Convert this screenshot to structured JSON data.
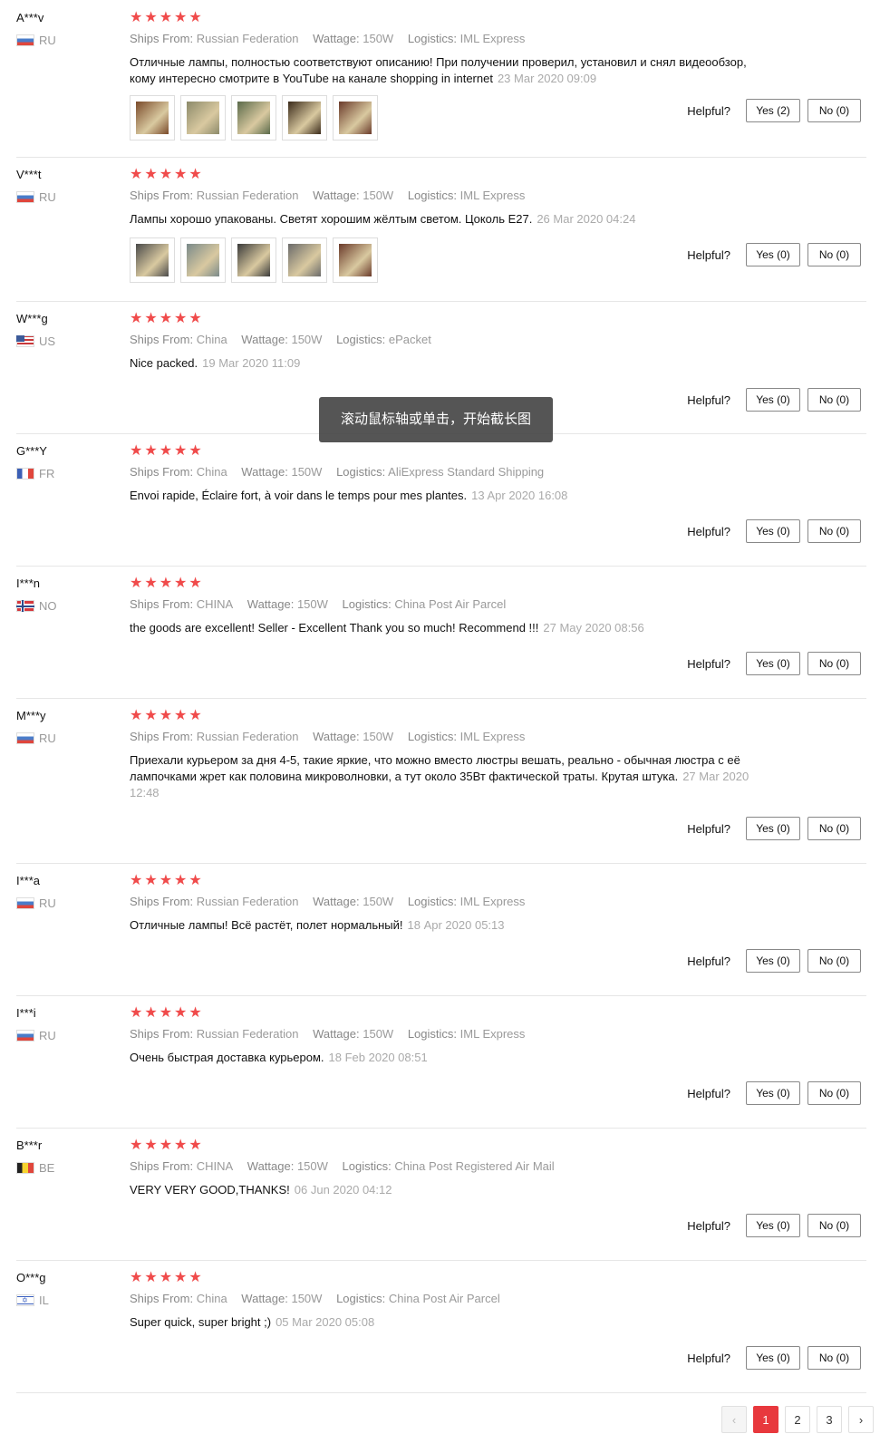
{
  "labels": {
    "ships_from": "Ships From:",
    "wattage": "Wattage:",
    "logistics": "Logistics:",
    "helpful": "Helpful?"
  },
  "toast": "滚动鼠标轴或单击，开始截长图",
  "reviews": [
    {
      "name": "A***v",
      "country": "RU",
      "flag": "ru",
      "ships_from": "Russian Federation",
      "wattage": "150W",
      "logistics": "IML Express",
      "text": "Отличные лампы, полностью соответствуют описанию! При получении проверил, установил и снял видеообзор, кому интересно смотрите в YouTube на канале shopping in internet",
      "date": "23 Mar 2020 09:09",
      "yes": "Yes (2)",
      "no": "No (0)",
      "photos": [
        "#7a4a2a",
        "#8c8a6a",
        "#5a6a4a",
        "#3a2a1a",
        "#6a3a2a"
      ]
    },
    {
      "name": "V***t",
      "country": "RU",
      "flag": "ru",
      "ships_from": "Russian Federation",
      "wattage": "150W",
      "logistics": "IML Express",
      "text": "Лампы хорошо упакованы. Светят хорошим жёлтым светом. Цоколь E27.",
      "date": "26 Mar 2020 04:24",
      "yes": "Yes (0)",
      "no": "No (0)",
      "photos": [
        "#4a4a4a",
        "#7a8a8a",
        "#3a3a3a",
        "#6a6a6a",
        "#6a3a2a"
      ]
    },
    {
      "name": "W***g",
      "country": "US",
      "flag": "us",
      "ships_from": "China",
      "wattage": "150W",
      "logistics": "ePacket",
      "text": "Nice packed.",
      "date": "19 Mar 2020 11:09",
      "yes": "Yes (0)",
      "no": "No (0)",
      "photos": []
    },
    {
      "name": "G***Y",
      "country": "FR",
      "flag": "fr",
      "ships_from": "China",
      "wattage": "150W",
      "logistics": "AliExpress Standard Shipping",
      "text": "Envoi rapide, Éclaire fort, à voir dans le temps pour mes plantes.",
      "date": "13 Apr 2020 16:08",
      "yes": "Yes (0)",
      "no": "No (0)",
      "photos": []
    },
    {
      "name": "I***n",
      "country": "NO",
      "flag": "no",
      "ships_from": "CHINA",
      "wattage": "150W",
      "logistics": "China Post Air Parcel",
      "text": "the goods are excellent! Seller - Excellent Thank you so much! Recommend !!!",
      "date": "27 May 2020 08:56",
      "yes": "Yes (0)",
      "no": "No (0)",
      "photos": []
    },
    {
      "name": "M***y",
      "country": "RU",
      "flag": "ru",
      "ships_from": "Russian Federation",
      "wattage": "150W",
      "logistics": "IML Express",
      "text": "Приехали курьером за дня 4-5, такие яркие, что можно вместо люстры вешать, реально - обычная люстра с её лампочками жрет как половина микроволновки, а тут около 35Вт фактической траты. Крутая штука.",
      "date": "27 Mar 2020 12:48",
      "yes": "Yes (0)",
      "no": "No (0)",
      "photos": []
    },
    {
      "name": "I***a",
      "country": "RU",
      "flag": "ru",
      "ships_from": "Russian Federation",
      "wattage": "150W",
      "logistics": "IML Express",
      "text": "Отличные лампы! Всё растёт, полет нормальный!",
      "date": "18 Apr 2020 05:13",
      "yes": "Yes (0)",
      "no": "No (0)",
      "photos": []
    },
    {
      "name": "I***i",
      "country": "RU",
      "flag": "ru",
      "ships_from": "Russian Federation",
      "wattage": "150W",
      "logistics": "IML Express",
      "text": "Очень быстрая доставка курьером.",
      "date": "18 Feb 2020 08:51",
      "yes": "Yes (0)",
      "no": "No (0)",
      "photos": []
    },
    {
      "name": "B***r",
      "country": "BE",
      "flag": "be",
      "ships_from": "CHINA",
      "wattage": "150W",
      "logistics": "China Post Registered Air Mail",
      "text": "VERY VERY GOOD,THANKS!",
      "date": "06 Jun 2020 04:12",
      "yes": "Yes (0)",
      "no": "No (0)",
      "photos": []
    },
    {
      "name": "O***g",
      "country": "IL",
      "flag": "il",
      "ships_from": "China",
      "wattage": "150W",
      "logistics": "China Post Air Parcel",
      "text": "Super quick, super bright ;)",
      "date": "05 Mar 2020 05:08",
      "yes": "Yes (0)",
      "no": "No (0)",
      "photos": []
    }
  ],
  "pagination": {
    "prev": "‹",
    "pages": [
      "1",
      "2",
      "3"
    ],
    "current": "1",
    "next": "›"
  }
}
